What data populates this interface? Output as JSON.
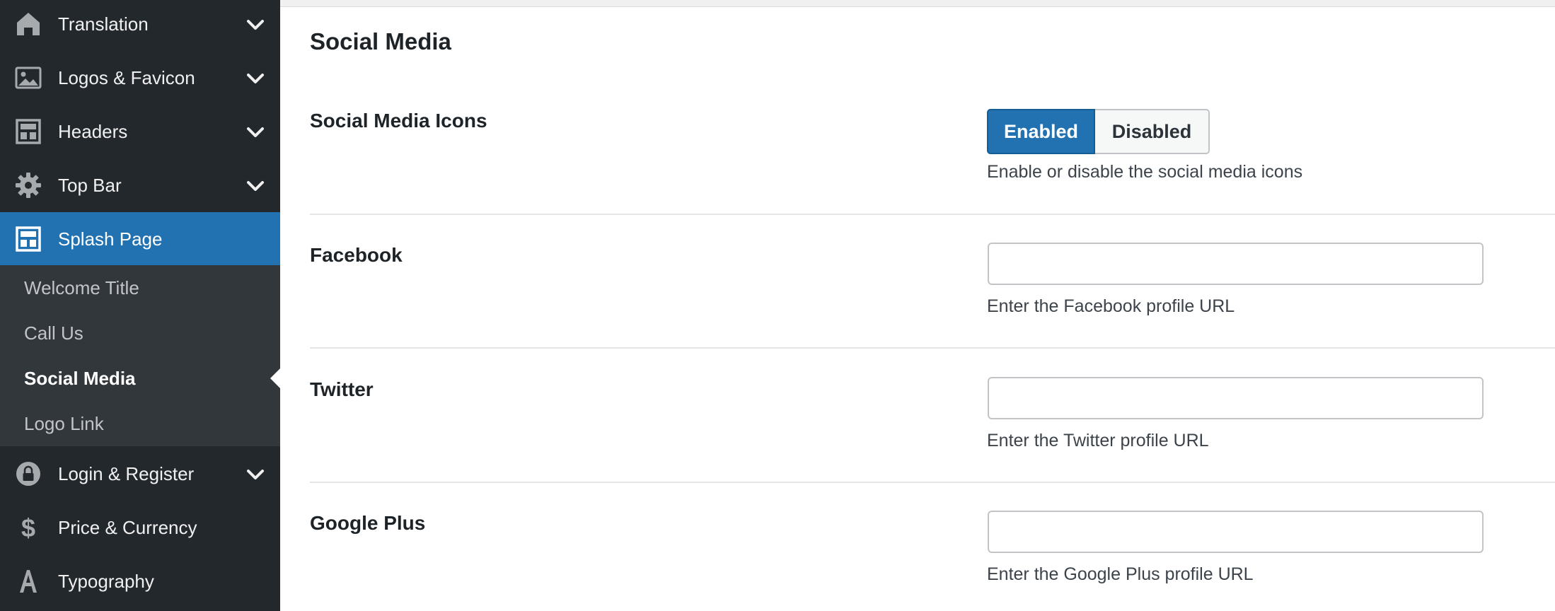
{
  "sidebar": {
    "items_top": [
      {
        "label": "Translation",
        "icon": "home-icon"
      },
      {
        "label": "Logos & Favicon",
        "icon": "image-icon"
      },
      {
        "label": "Headers",
        "icon": "layout-icon"
      },
      {
        "label": "Top Bar",
        "icon": "gear-icon"
      }
    ],
    "active_item": {
      "label": "Splash Page",
      "icon": "layout-icon"
    },
    "submenu": [
      {
        "label": "Welcome Title"
      },
      {
        "label": "Call Us"
      },
      {
        "label": "Social Media",
        "current": true
      },
      {
        "label": "Logo Link"
      }
    ],
    "items_bottom": [
      {
        "label": "Login & Register",
        "icon": "lock-icon"
      },
      {
        "label": "Price & Currency",
        "icon": "dollar-icon"
      },
      {
        "label": "Typography",
        "icon": "typography-icon"
      }
    ]
  },
  "main": {
    "section_title": "Social Media",
    "social_icons": {
      "label": "Social Media Icons",
      "enabled_label": "Enabled",
      "disabled_label": "Disabled",
      "selected": "Enabled",
      "description": "Enable or disable the social media icons"
    },
    "facebook": {
      "label": "Facebook",
      "value": "",
      "description": "Enter the Facebook profile URL"
    },
    "twitter": {
      "label": "Twitter",
      "value": "",
      "description": "Enter the Twitter profile URL"
    },
    "google_plus": {
      "label": "Google Plus",
      "value": "",
      "description": "Enter the Google Plus profile URL"
    }
  },
  "colors": {
    "sidebar_bg": "#23282d",
    "submenu_bg": "#32373c",
    "accent": "#2271b1",
    "text": "#1d2327"
  }
}
